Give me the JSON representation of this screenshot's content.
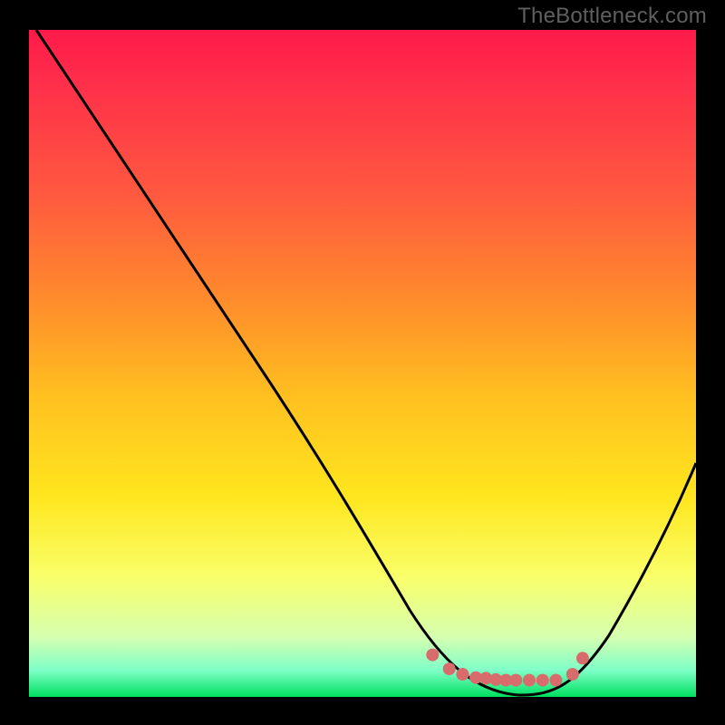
{
  "watermark": "TheBottleneck.com",
  "chart_data": {
    "type": "line",
    "title": "",
    "xlabel": "",
    "ylabel": "",
    "xlim": [
      0,
      100
    ],
    "ylim": [
      0,
      100
    ],
    "series": [
      {
        "name": "bottleneck-curve",
        "x": [
          1,
          10,
          20,
          30,
          40,
          47,
          56,
          60,
          64,
          70,
          74,
          80,
          88,
          95,
          100
        ],
        "values": [
          100,
          87,
          73,
          59,
          44,
          34,
          21,
          14,
          7,
          1,
          0,
          0,
          10,
          24,
          36
        ]
      }
    ],
    "markers": {
      "name": "highlight-dots",
      "color": "#d86c6c",
      "points": [
        {
          "x": 60.5,
          "y": 6.3
        },
        {
          "x": 63.0,
          "y": 4.2
        },
        {
          "x": 65.0,
          "y": 3.4
        },
        {
          "x": 67.0,
          "y": 2.9
        },
        {
          "x": 68.5,
          "y": 2.8
        },
        {
          "x": 70.0,
          "y": 2.6
        },
        {
          "x": 71.5,
          "y": 2.5
        },
        {
          "x": 73.0,
          "y": 2.5
        },
        {
          "x": 75.0,
          "y": 2.5
        },
        {
          "x": 77.0,
          "y": 2.5
        },
        {
          "x": 79.0,
          "y": 2.5
        },
        {
          "x": 81.5,
          "y": 3.4
        },
        {
          "x": 83.0,
          "y": 5.8
        }
      ]
    }
  }
}
